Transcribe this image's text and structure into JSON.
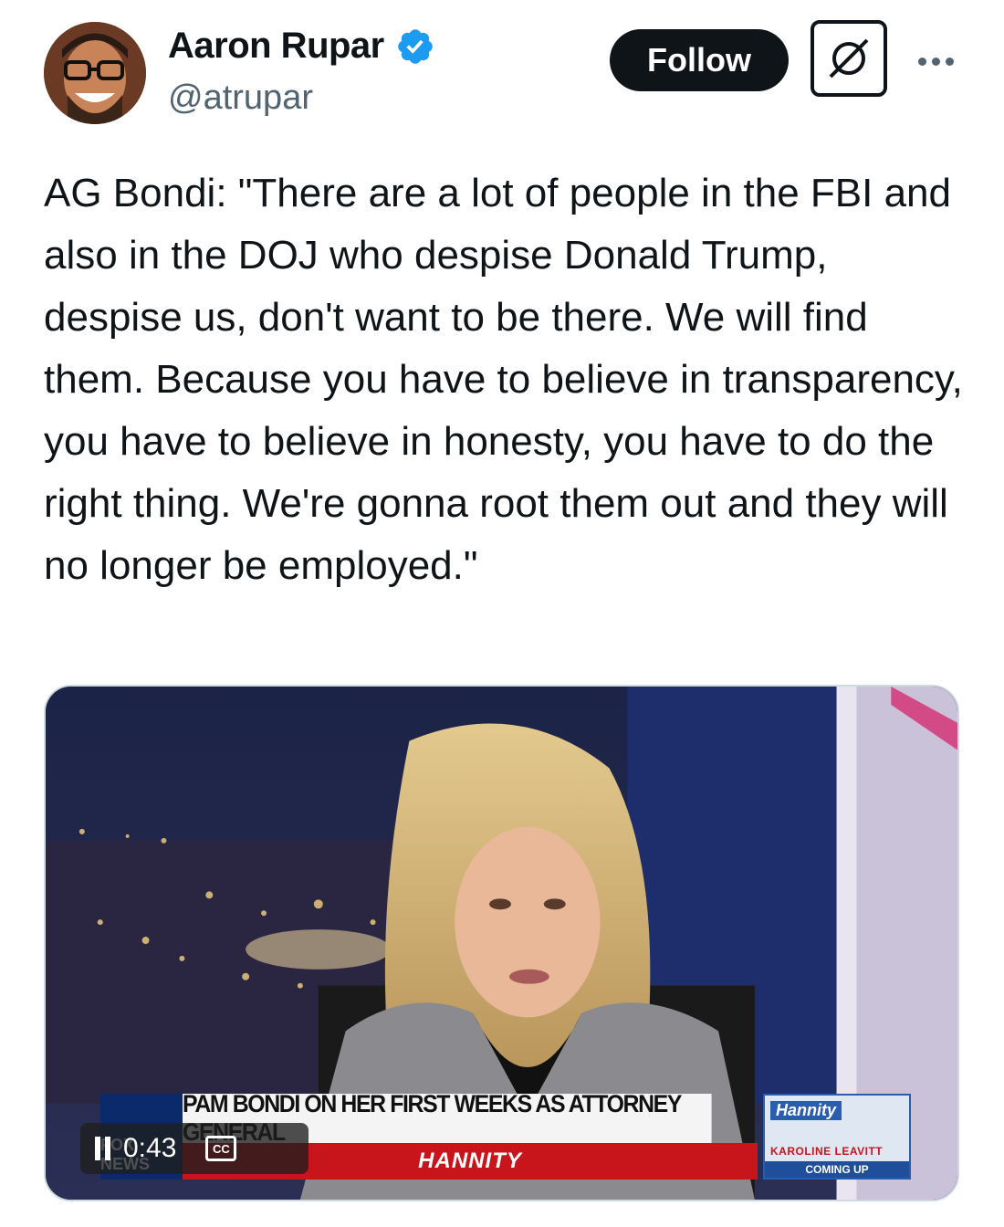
{
  "author": {
    "display_name": "Aaron Rupar",
    "handle": "@atrupar",
    "verified": true,
    "avatar_icon": "avatar-photo"
  },
  "actions": {
    "follow_label": "Follow",
    "grok_icon": "grok-icon",
    "more_icon": "more-dots-icon"
  },
  "tweet": {
    "text": "AG Bondi: \"There are a lot of people in the FBI and also in the DOJ who despise Donald Trump, despise us, don't want to be there. We will find them. Because you have to believe in transparency, you have to believe in honesty, you have to do the right thing. We're gonna root them out and they will no longer be employed.\""
  },
  "video": {
    "chyron_headline": "PAM BONDI ON HER FIRST WEEKS AS ATTORNEY GENERAL",
    "chyron_show": "HANNITY",
    "network_logo_text": "FOX NEWS",
    "promo_show": "Hannity",
    "promo_guest": "KAROLINE LEAVITT",
    "promo_sub": "COMING UP",
    "elapsed": "0:43",
    "cc_label": "CC",
    "pause_icon": "pause-icon",
    "cc_icon": "closed-captions-icon"
  },
  "colors": {
    "text_primary": "#0f1419",
    "text_secondary": "#536471",
    "verified_blue": "#1d9bf0",
    "follow_bg": "#0f1419"
  }
}
